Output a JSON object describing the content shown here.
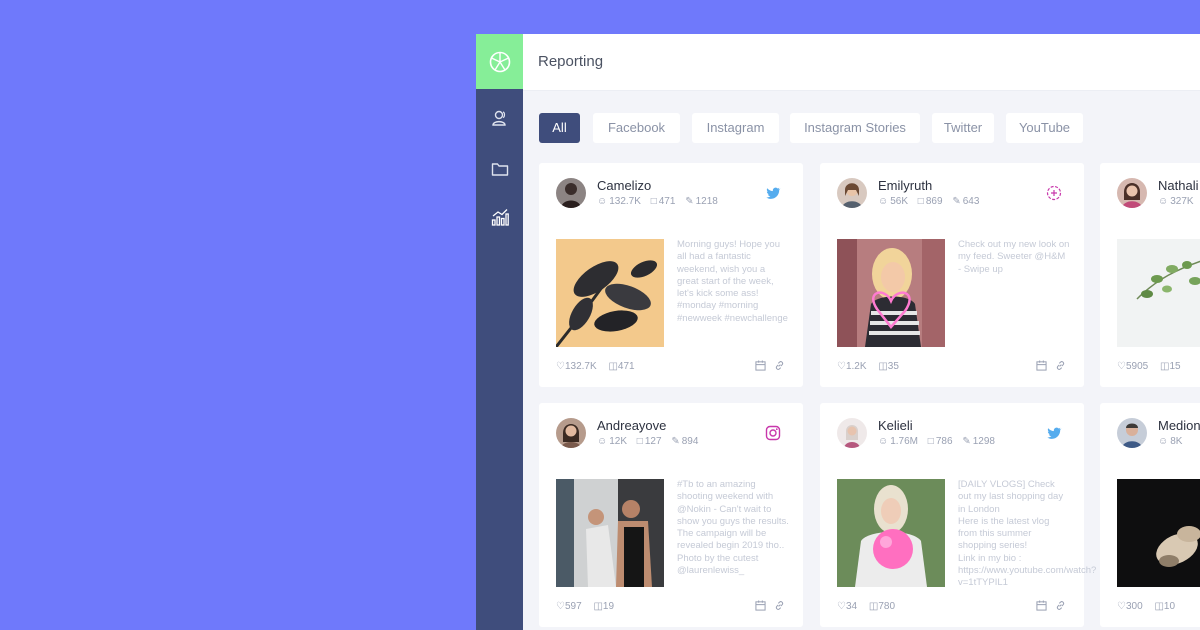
{
  "header": {
    "title": "Reporting"
  },
  "tabs": [
    {
      "label": "All",
      "active": true
    },
    {
      "label": "Facebook",
      "active": false
    },
    {
      "label": "Instagram",
      "active": false
    },
    {
      "label": "Instagram Stories",
      "active": false
    },
    {
      "label": "Twitter",
      "active": false
    },
    {
      "label": "YouTube",
      "active": false
    }
  ],
  "colors": {
    "background": "#6f79fb",
    "sidebar": "#3f4d7c",
    "logo": "#86ee98",
    "twitter": "#1da1f2",
    "instagram": "#c837ab"
  },
  "sidebar_icons": [
    "network-logo-icon",
    "users-icon",
    "folder-icon",
    "analytics-icon"
  ],
  "cards": [
    {
      "username": "Camelizo",
      "audience": "132.7K",
      "saves": "471",
      "posts": "1218",
      "platform": "twitter-icon",
      "text": "Morning guys! Hope you all had a fantastic weekend, wish you a great start of the week, let's kick some ass!\n#monday #morning #newweek #newchallenge",
      "likes": "132.7K",
      "comments": "471"
    },
    {
      "username": "Emilyruth",
      "audience": "56K",
      "saves": "869",
      "posts": "643",
      "platform": "instagram-stories-icon",
      "text": "Check out my new look on my feed. Sweeter @H&M - Swipe up",
      "likes": "1.2K",
      "comments": "35"
    },
    {
      "username": "Nathali",
      "audience": "327K",
      "saves": "",
      "posts": "",
      "platform": "",
      "text": "",
      "likes": "5905",
      "comments": "15"
    },
    {
      "username": "Andreayove",
      "audience": "12K",
      "saves": "127",
      "posts": "894",
      "platform": "instagram-icon",
      "text": "#Tb to an amazing shooting weekend with @Nokin - Can't wait to show you guys the results. The campaign will be revealed begin 2019 tho.. Photo by the cutest @laurenlewiss_",
      "likes": "597",
      "comments": "19"
    },
    {
      "username": "Kelieli",
      "audience": "1.76M",
      "saves": "786",
      "posts": "1298",
      "platform": "twitter-icon",
      "text": "[DAILY VLOGS] Check out my last shopping day in London\nHere is the latest vlog from this summer shopping series!\nLink in my bio : https://www.youtube.com/watch?v=1tTYPIL1",
      "likes": "34",
      "comments": "780"
    },
    {
      "username": "Medion",
      "audience": "8K",
      "saves": "",
      "posts": "",
      "platform": "",
      "text": "",
      "likes": "300",
      "comments": "10"
    }
  ]
}
